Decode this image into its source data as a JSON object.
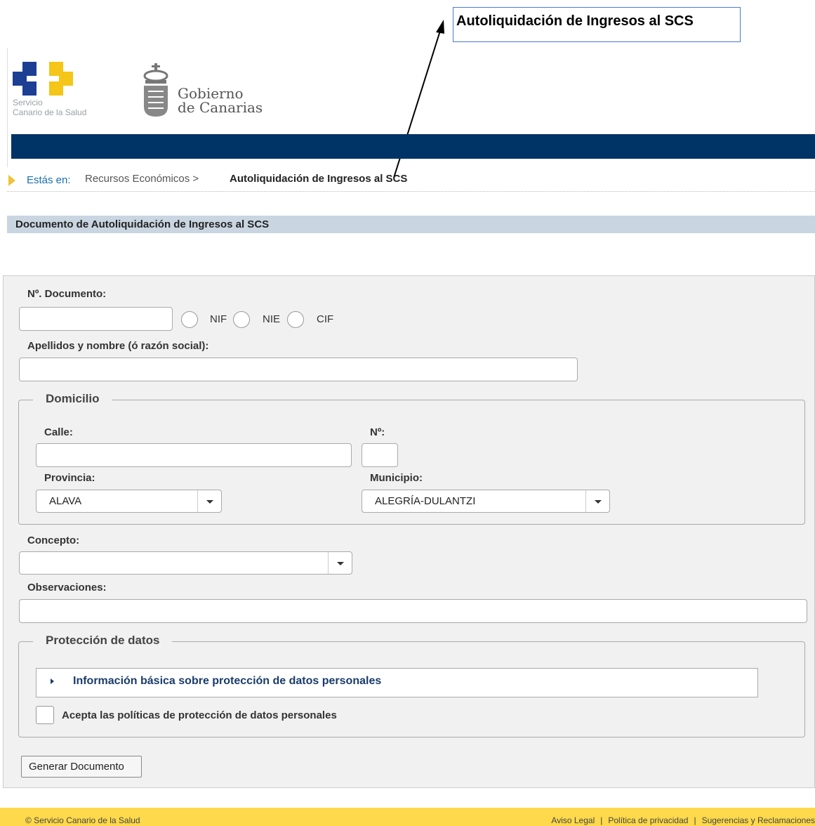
{
  "callout": {
    "title": "Autoliquidación de Ingresos al SCS"
  },
  "header": {
    "scs_logo_line1": "Servicio",
    "scs_logo_line2": "Canario de la Salud",
    "gc_logo_line1": "Gobierno",
    "gc_logo_line2": "de Canarias",
    "colors": {
      "navbar": "#003366",
      "scs_blue": "#1c3f94",
      "scs_yellow": "#f5c518"
    }
  },
  "breadcrumb": {
    "prefix": "Estás en:",
    "crumb1": "Recursos Económicos >",
    "current": "Autoliquidación de Ingresos al SCS"
  },
  "section_title": "Documento de Autoliquidación de Ingresos al SCS",
  "form": {
    "doc_label": "Nº. Documento:",
    "doc_value": "",
    "doc_types": [
      "NIF",
      "NIE",
      "CIF"
    ],
    "name_label": "Apellidos y nombre (ó razón social):",
    "name_value": "",
    "domicilio": {
      "legend": "Domicilio",
      "calle_label": "Calle:",
      "calle_value": "",
      "numero_label": "Nº:",
      "numero_value": "",
      "provincia_label": "Provincia:",
      "provincia_value": "ALAVA",
      "municipio_label": "Municipio:",
      "municipio_value": "ALEGRÍA-DULANTZI"
    },
    "concepto_label": "Concepto:",
    "concepto_value": "",
    "observaciones_label": "Observaciones:",
    "observaciones_value": "",
    "proteccion": {
      "legend": "Protección de datos",
      "info_link": "Información básica sobre protección de datos personales",
      "accept_label": "Acepta las políticas de protección de datos personales"
    },
    "submit_label": "Generar Documento"
  },
  "footer": {
    "copyright": "© Servicio Canario de la Salud",
    "links": [
      "Aviso Legal",
      "Política de privacidad",
      "Sugerencias y Reclamaciones"
    ],
    "color": "#fdd94b"
  }
}
